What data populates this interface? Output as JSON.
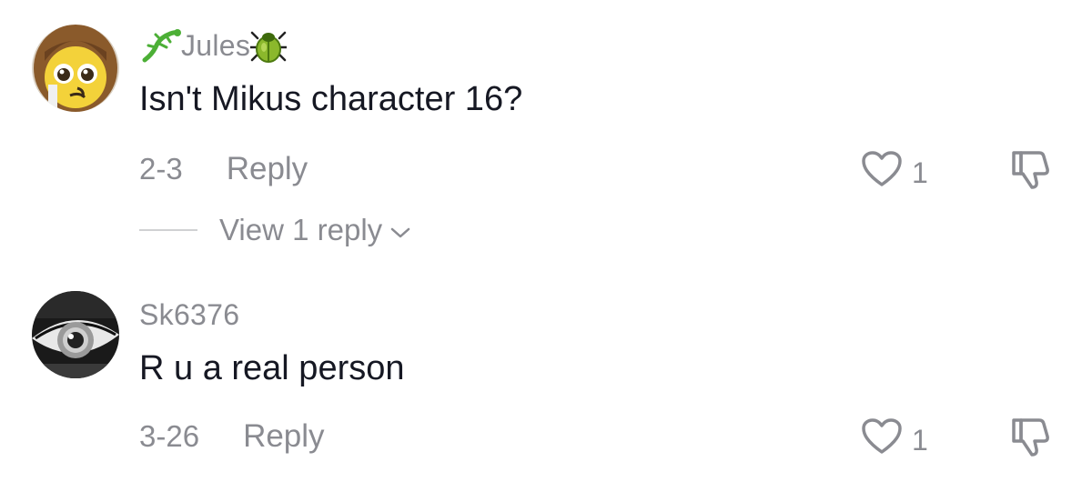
{
  "comments": [
    {
      "username": "Jules",
      "username_prefix_icon": "lizard-emoji",
      "username_suffix_icon": "beetle-emoji",
      "text": "Isn't Mikus character 16?",
      "date": "2-3",
      "reply_label": "Reply",
      "like_count": "1",
      "view_replies_label": "View 1 reply"
    },
    {
      "username": "Sk6376",
      "text": "R u a real person",
      "date": "3-26",
      "reply_label": "Reply",
      "like_count": "1"
    }
  ],
  "colors": {
    "text_primary": "#161823",
    "text_secondary": "#8a8b91",
    "divider": "#d0d1d3",
    "background": "#ffffff"
  }
}
